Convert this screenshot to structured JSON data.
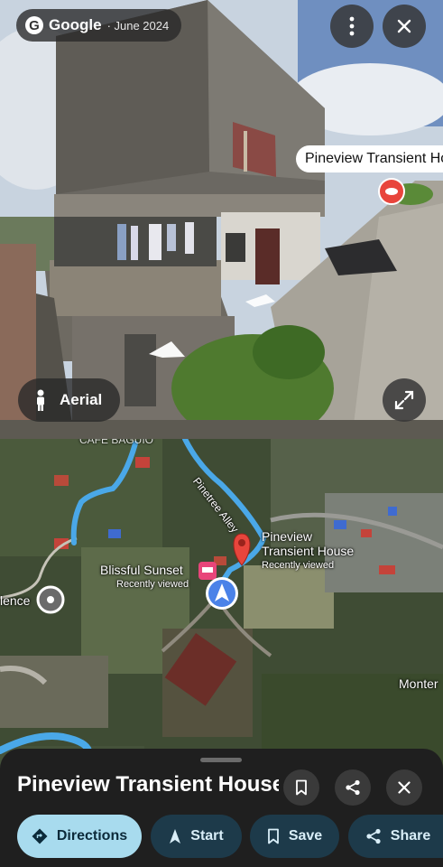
{
  "street_view": {
    "brand": "Google",
    "date": "· June 2024",
    "place_label": "Pineview Transient House",
    "aerial_label": "Aerial"
  },
  "map": {
    "road_label": "Pinetree Alley",
    "selected_place": {
      "name_line1": "Pineview",
      "name_line2": "Transient House",
      "status": "Recently viewed"
    },
    "other_place": {
      "name": "Blissful Sunset",
      "status": "Recently viewed"
    },
    "left_edge_label": "lence",
    "right_edge_label": "Monter",
    "top_edge_label": "CAFÉ BAGUIO"
  },
  "sheet": {
    "title": "Pineview Transient House",
    "actions": {
      "directions": "Directions",
      "start": "Start",
      "save": "Save",
      "share": "Share"
    }
  },
  "colors": {
    "accent": "#a8dbee",
    "pin": "#e8453c",
    "route": "#4aa8e8",
    "sheet": "#1f1f1f"
  }
}
